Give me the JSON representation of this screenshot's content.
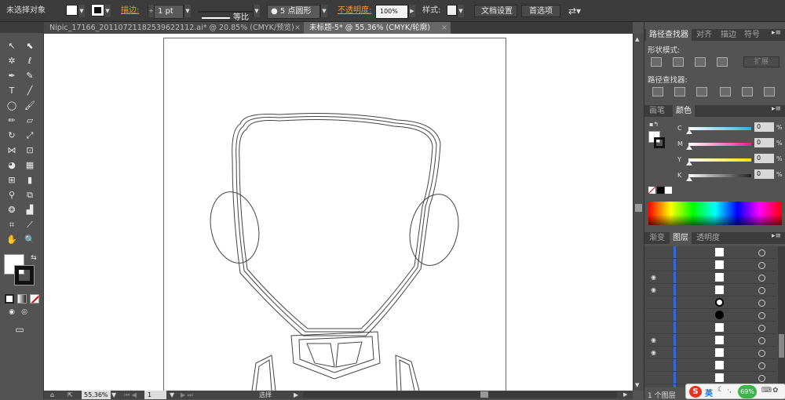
{
  "control_bar": {
    "selection_label": "未选择对象",
    "stroke_label": "描边:",
    "stroke_weight": "1 pt",
    "stroke_profile": "等比",
    "brush": "5 点圆形",
    "opacity_label": "不透明度:",
    "opacity_value": "100%",
    "style_label": "样式:",
    "doc_setup_button": "文档设置",
    "preferences_button": "首选项"
  },
  "doc_tabs": [
    {
      "title": "Nipic_17166_20110721182539622112.ai* @ 20.85% (CMYK/预览)",
      "close": "×"
    },
    {
      "title": "未标题-5* @ 55.36% (CMYK/轮廓)",
      "close": "×"
    }
  ],
  "status_bar": {
    "zoom": "55.36%",
    "artboard_number": "1",
    "tool_status": "选择"
  },
  "panels": {
    "pathfinder_tabs": [
      "路径查找器",
      "对齐",
      "描边",
      "符号"
    ],
    "shape_modes_label": "形状模式:",
    "expand_button": "扩展",
    "pathfinders_label": "路径查找器:",
    "color_tabs": [
      "画笔",
      "颜色"
    ],
    "color_channels": [
      {
        "name": "C",
        "value": "0",
        "unit": "%",
        "color": "#29b6d6"
      },
      {
        "name": "M",
        "value": "0",
        "unit": "%",
        "color": "#e0218a"
      },
      {
        "name": "Y",
        "value": "0",
        "unit": "%",
        "color": "#f5e400"
      },
      {
        "name": "K",
        "value": "0",
        "unit": "%",
        "color": "#222222"
      }
    ],
    "layers_tabs": [
      "渐变",
      "图层",
      "透明度"
    ],
    "layers_count": "1 个图层"
  },
  "ime_bar": {
    "lang": "英",
    "battery": "69%"
  }
}
